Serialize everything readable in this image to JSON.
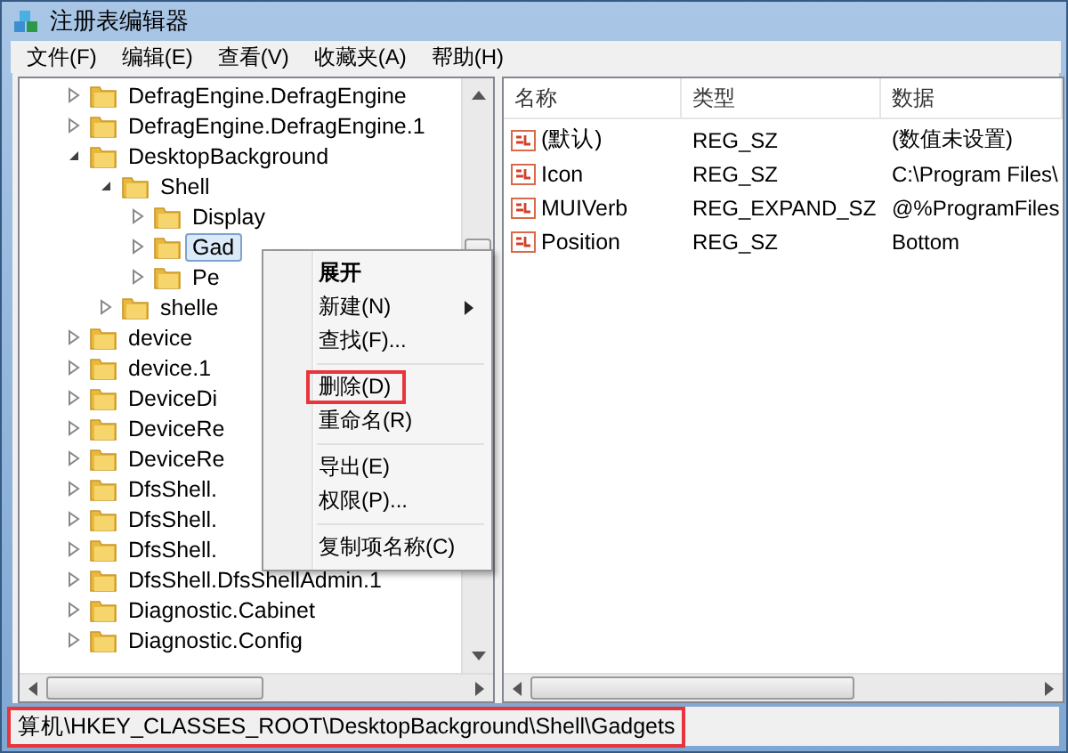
{
  "window": {
    "title": "注册表编辑器"
  },
  "menu_bar": [
    "文件(F)",
    "编辑(E)",
    "查看(V)",
    "收藏夹(A)",
    "帮助(H)"
  ],
  "tree": [
    {
      "label": "DefragEngine.DefragEngine",
      "expanded": false,
      "selected": false
    },
    {
      "label": "DefragEngine.DefragEngine.1",
      "expanded": false,
      "selected": false
    },
    {
      "label": "DesktopBackground",
      "expanded": true,
      "selected": false,
      "children": [
        {
          "label": "Shell",
          "expanded": true,
          "selected": false,
          "children": [
            {
              "label": "Display",
              "expanded": false,
              "selected": false
            },
            {
              "label": "Gad",
              "expanded": false,
              "selected": true
            },
            {
              "label": "Pe",
              "expanded": false,
              "selected": false
            }
          ]
        },
        {
          "label": "shelle",
          "expanded": false,
          "selected": false
        }
      ]
    },
    {
      "label": "device",
      "expanded": false,
      "selected": false
    },
    {
      "label": "device.1",
      "expanded": false,
      "selected": false
    },
    {
      "label": "DeviceDi",
      "expanded": false,
      "selected": false
    },
    {
      "label": "DeviceRe",
      "expanded": false,
      "selected": false
    },
    {
      "label": "DeviceRe",
      "expanded": false,
      "selected": false
    },
    {
      "label": "DfsShell.",
      "expanded": false,
      "selected": false
    },
    {
      "label": "DfsShell.",
      "expanded": false,
      "selected": false
    },
    {
      "label": "DfsShell.",
      "expanded": false,
      "selected": false
    },
    {
      "label": "DfsShell.DfsShellAdmin.1",
      "expanded": false,
      "selected": false
    },
    {
      "label": "Diagnostic.Cabinet",
      "expanded": false,
      "selected": false
    },
    {
      "label": "Diagnostic.Config",
      "expanded": false,
      "selected": false
    }
  ],
  "values_table": {
    "columns": [
      "名称",
      "类型",
      "数据"
    ],
    "rows": [
      {
        "name": "(默认)",
        "type": "REG_SZ",
        "data": "(数值未设置)"
      },
      {
        "name": "Icon",
        "type": "REG_SZ",
        "data": "C:\\Program Files\\"
      },
      {
        "name": "MUIVerb",
        "type": "REG_EXPAND_SZ",
        "data": "@%ProgramFiles"
      },
      {
        "name": "Position",
        "type": "REG_SZ",
        "data": "Bottom"
      }
    ]
  },
  "context_menu": [
    {
      "kind": "item",
      "label": "展开",
      "bold": true,
      "submenu": false,
      "highlighted": false
    },
    {
      "kind": "item",
      "label": "新建(N)",
      "bold": false,
      "submenu": true,
      "highlighted": false
    },
    {
      "kind": "item",
      "label": "查找(F)...",
      "bold": false,
      "submenu": false,
      "highlighted": false
    },
    {
      "kind": "separator"
    },
    {
      "kind": "item",
      "label": "删除(D)",
      "bold": false,
      "submenu": false,
      "highlighted": true
    },
    {
      "kind": "item",
      "label": "重命名(R)",
      "bold": false,
      "submenu": false,
      "highlighted": false
    },
    {
      "kind": "separator"
    },
    {
      "kind": "item",
      "label": "导出(E)",
      "bold": false,
      "submenu": false,
      "highlighted": false
    },
    {
      "kind": "item",
      "label": "权限(P)...",
      "bold": false,
      "submenu": false,
      "highlighted": false
    },
    {
      "kind": "separator"
    },
    {
      "kind": "item",
      "label": "复制项名称(C)",
      "bold": false,
      "submenu": false,
      "highlighted": false
    }
  ],
  "status_bar": {
    "text": "算机\\HKEY_CLASSES_ROOT\\DesktopBackground\\Shell\\Gadgets",
    "highlighted": true
  }
}
